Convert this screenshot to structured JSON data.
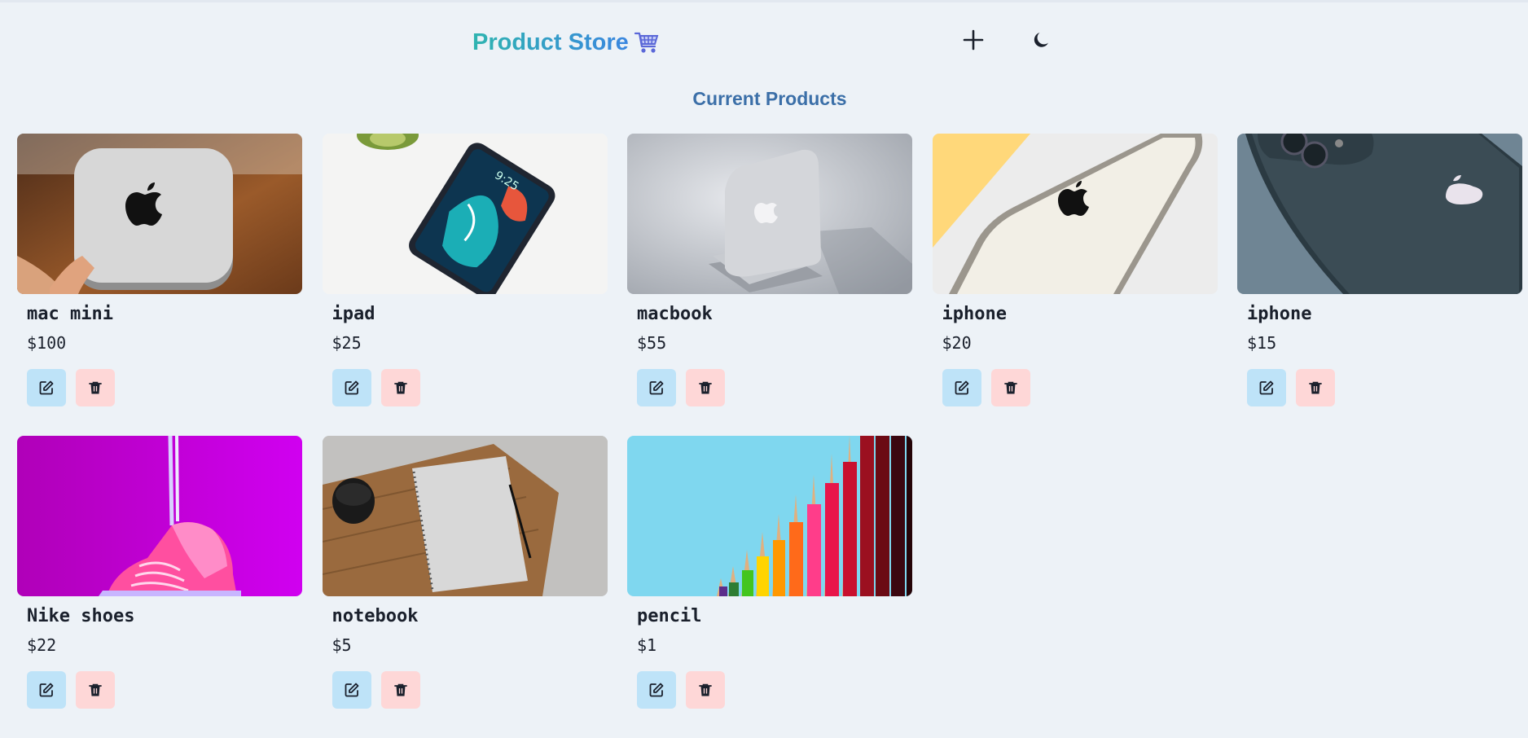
{
  "header": {
    "brand": "Product Store",
    "brand_colors": [
      "#2fb4b0",
      "#3a86e0"
    ],
    "add_icon": "plus-icon",
    "theme_icon": "moon-icon"
  },
  "section_title": "Current Products",
  "colors": {
    "background": "#edf2f7",
    "edit_button": "#bee3f8",
    "delete_button": "#fed7d7",
    "title": "#3b6fa8"
  },
  "products": [
    {
      "name": "mac mini",
      "price": "$100",
      "image": "mac-mini-photo"
    },
    {
      "name": "ipad",
      "price": "$25",
      "image": "ipad-photo"
    },
    {
      "name": "macbook",
      "price": "$55",
      "image": "macbook-photo"
    },
    {
      "name": "iphone",
      "price": "$20",
      "image": "iphone-white-photo"
    },
    {
      "name": "iphone",
      "price": "$15",
      "image": "iphone-dark-photo"
    },
    {
      "name": "Nike shoes",
      "price": "$22",
      "image": "sneaker-photo"
    },
    {
      "name": "notebook",
      "price": "$5",
      "image": "notebook-photo"
    },
    {
      "name": "pencil",
      "price": "$1",
      "image": "pencils-photo"
    }
  ]
}
